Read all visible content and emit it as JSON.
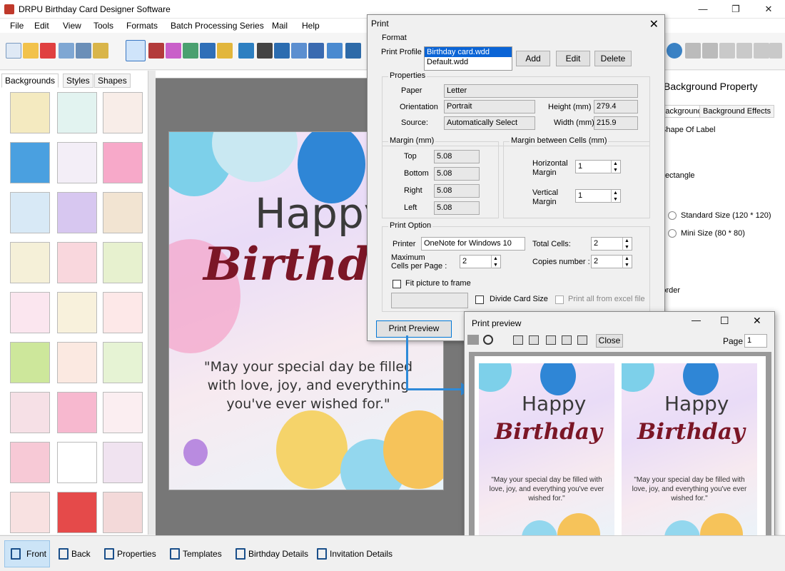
{
  "window": {
    "title": "DRPU Birthday Card Designer Software",
    "minimize": "—",
    "restore": "❐",
    "close": "✕"
  },
  "menu": [
    "File",
    "Edit",
    "View",
    "Tools",
    "Formats",
    "Batch Processing Series",
    "Mail",
    "Help"
  ],
  "left_panel": {
    "tabs": [
      "Backgrounds",
      "Styles",
      "Shapes"
    ]
  },
  "card": {
    "happy": "Happy",
    "birthday": "Birthday",
    "quote": "\"May your special day be filled with love, joy, and everything you've ever wished for.\""
  },
  "right_panel": {
    "title": "Background Property",
    "tabs": [
      "Background",
      "Background Effects"
    ],
    "shape_label": "Shape Of Label",
    "rectangle": "Rectangle",
    "standard_size": "Standard Size (120 * 120)",
    "mini_size": "Mini Size (80 * 80)",
    "border_label": "Border"
  },
  "print_dialog": {
    "title": "Print",
    "close": "✕",
    "format": {
      "label": "Format",
      "profile_label": "Print Profile",
      "profiles": [
        "Birthday card.wdd",
        "Default.wdd"
      ],
      "add": "Add",
      "edit": "Edit",
      "delete": "Delete"
    },
    "properties": {
      "label": "Properties",
      "paper_label": "Paper",
      "paper": "Letter",
      "orientation_label": "Orientation",
      "orientation": "Portrait",
      "source_label": "Source:",
      "source": "Automatically Select",
      "height_label": "Height (mm)",
      "height": "279.4",
      "width_label": "Width (mm)",
      "width": "215.9"
    },
    "margin": {
      "label": "Margin (mm)",
      "top_label": "Top",
      "top": "5.08",
      "bottom_label": "Bottom",
      "bottom": "5.08",
      "right_label": "Right",
      "right": "5.08",
      "left_label": "Left",
      "left": "5.08"
    },
    "cells": {
      "label": "Margin between Cells (mm)",
      "horizontal_label": "Horizontal\nMargin",
      "horizontal": "1",
      "vertical_label": "Vertical\nMargin",
      "vertical": "1"
    },
    "option": {
      "label": "Print Option",
      "printer_label": "Printer",
      "printer": "OneNote for Windows 10",
      "total_label": "Total Cells:",
      "total": "2",
      "max_label": "Maximum\nCells per Page :",
      "max": "2",
      "copies_label": "Copies number :",
      "copies": "2",
      "fit_label": "Fit picture to frame",
      "divide_label": "Divide Card Size",
      "excel_label": "Print all from excel file"
    },
    "preview_button": "Print Preview"
  },
  "preview": {
    "title": "Print preview",
    "close_btn": "Close",
    "page_label": "Page",
    "page": "1",
    "minimize": "—",
    "maximize": "☐",
    "close": "✕"
  },
  "bottom": [
    "Front",
    "Back",
    "Properties",
    "Templates",
    "Birthday Details",
    "Invitation Details"
  ]
}
